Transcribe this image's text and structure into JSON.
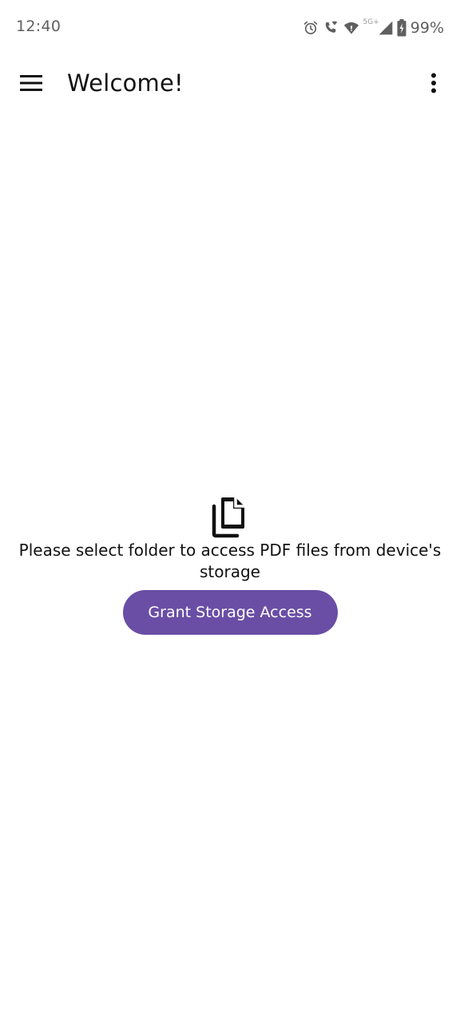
{
  "status_bar": {
    "time": "12:40",
    "network_label": "5G+",
    "battery_percent": "99%",
    "icons": [
      "alarm-icon",
      "wifi-calling-icon",
      "wifi-icon",
      "cellular-signal-icon",
      "battery-charging-icon"
    ]
  },
  "app_bar": {
    "title": "Welcome!",
    "menu_icon": "hamburger-menu-icon",
    "overflow_icon": "more-vert-icon"
  },
  "empty_state": {
    "icon": "files-icon",
    "message": "Please select folder to access PDF files from device's storage",
    "button_label": "Grant Storage Access"
  },
  "colors": {
    "accent": "#6a4ea5",
    "background": "#ffffff",
    "status_text": "#5f5f5f"
  }
}
